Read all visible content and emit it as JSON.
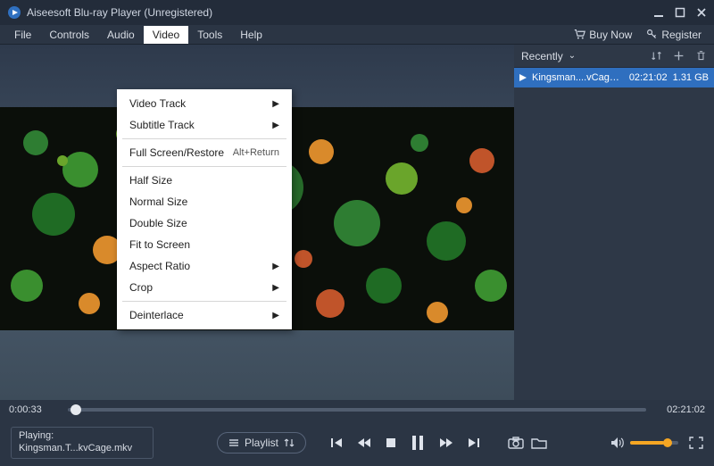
{
  "app": {
    "title": "Aiseesoft Blu-ray Player (Unregistered)"
  },
  "menubar": {
    "items": [
      "File",
      "Controls",
      "Audio",
      "Video",
      "Tools",
      "Help"
    ],
    "active_index": 3,
    "buy_now": "Buy Now",
    "register": "Register"
  },
  "video_menu": {
    "items": [
      {
        "label": "Video Track",
        "submenu": true
      },
      {
        "label": "Subtitle Track",
        "submenu": true
      },
      {
        "sep": true
      },
      {
        "label": "Full Screen/Restore",
        "accel": "Alt+Return"
      },
      {
        "sep": true
      },
      {
        "label": "Half Size"
      },
      {
        "label": "Normal Size"
      },
      {
        "label": "Double Size"
      },
      {
        "label": "Fit to Screen"
      },
      {
        "label": "Aspect Ratio",
        "submenu": true
      },
      {
        "label": "Crop",
        "submenu": true
      },
      {
        "sep": true
      },
      {
        "label": "Deinterlace",
        "submenu": true
      }
    ]
  },
  "playlist": {
    "header": "Recently",
    "items": [
      {
        "name": "Kingsman....vCage.mkv",
        "duration": "02:21:02",
        "size": "1.31 GB",
        "playing": true
      }
    ]
  },
  "timeline": {
    "current": "0:00:33",
    "total": "02:21:02"
  },
  "status": {
    "label": "Playing:",
    "file": "Kingsman.T...kvCage.mkv"
  },
  "controls": {
    "playlist_label": "Playlist"
  }
}
